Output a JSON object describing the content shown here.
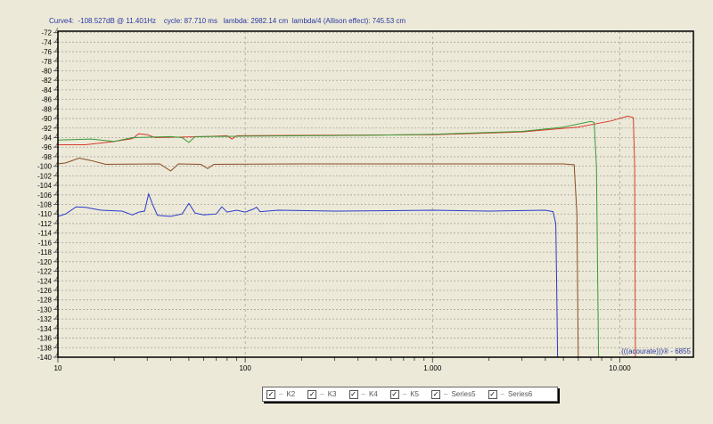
{
  "readout": "Curve4:  -108.527dB @ 11.401Hz    cycle: 87.710 ms   lambda: 2982.14 cm  lambda/4 (Allison effect): 745.53 cm",
  "watermark": "(((acourate)))® - 6855",
  "colors": {
    "bg": "#ece9d8",
    "grid": "#a8a49a"
  },
  "chart_data": {
    "type": "line",
    "xscale": "log",
    "xlim": [
      10,
      24700
    ],
    "ylim": [
      -140,
      -71.7
    ],
    "xticks": [
      {
        "v": 10,
        "label": "10"
      },
      {
        "v": 100,
        "label": "100"
      },
      {
        "v": 1000,
        "label": "1.000"
      },
      {
        "v": 10000,
        "label": "10.000"
      }
    ],
    "yticks": [
      -72,
      -74,
      -76,
      -78,
      -80,
      -82,
      -84,
      -86,
      -88,
      -90,
      -92,
      -94,
      -96,
      -98,
      -100,
      -102,
      -104,
      -106,
      -108,
      -110,
      -112,
      -114,
      -116,
      -118,
      -120,
      -122,
      -124,
      -126,
      -128,
      -130,
      -132,
      -134,
      -136,
      -138,
      -140
    ],
    "grid": true,
    "legend_position": "bottom-center",
    "series": [
      {
        "name": "K2",
        "color": "#d83a2a",
        "points": [
          [
            10,
            -95.5
          ],
          [
            14,
            -95.5
          ],
          [
            20,
            -94.8
          ],
          [
            25,
            -94.2
          ],
          [
            27,
            -93.2
          ],
          [
            30,
            -93.4
          ],
          [
            33,
            -94
          ],
          [
            60,
            -93.8
          ],
          [
            80,
            -93.6
          ],
          [
            85,
            -94.3
          ],
          [
            90,
            -93.6
          ],
          [
            300,
            -93.5
          ],
          [
            1000,
            -93.4
          ],
          [
            3000,
            -92.8
          ],
          [
            6000,
            -91.8
          ],
          [
            9000,
            -90.5
          ],
          [
            11000,
            -89.5
          ],
          [
            11800,
            -89.8
          ],
          [
            12000,
            -100
          ],
          [
            12100,
            -140
          ]
        ]
      },
      {
        "name": "K3",
        "color": "#3a9a3a",
        "points": [
          [
            10,
            -94.5
          ],
          [
            15,
            -94.3
          ],
          [
            20,
            -94.8
          ],
          [
            25,
            -94
          ],
          [
            40,
            -93.8
          ],
          [
            46,
            -94
          ],
          [
            50,
            -95
          ],
          [
            54,
            -93.8
          ],
          [
            100,
            -93.7
          ],
          [
            500,
            -93.5
          ],
          [
            1000,
            -93.3
          ],
          [
            3000,
            -92.7
          ],
          [
            5000,
            -91.8
          ],
          [
            7000,
            -90.6
          ],
          [
            7300,
            -90.8
          ],
          [
            7500,
            -100
          ],
          [
            7700,
            -140
          ]
        ]
      },
      {
        "name": "K4",
        "color": "#8a4a22",
        "points": [
          [
            10,
            -99.5
          ],
          [
            11,
            -99.3
          ],
          [
            13,
            -98.3
          ],
          [
            15,
            -98.8
          ],
          [
            18,
            -99.6
          ],
          [
            35,
            -99.5
          ],
          [
            40,
            -101
          ],
          [
            44,
            -99.5
          ],
          [
            58,
            -99.6
          ],
          [
            63,
            -100.5
          ],
          [
            68,
            -99.6
          ],
          [
            200,
            -99.5
          ],
          [
            1000,
            -99.5
          ],
          [
            5000,
            -99.5
          ],
          [
            5700,
            -99.7
          ],
          [
            5900,
            -110
          ],
          [
            6000,
            -140
          ]
        ]
      },
      {
        "name": "K5",
        "color": "#2a3ac8",
        "points": [
          [
            10,
            -110.5
          ],
          [
            11,
            -110
          ],
          [
            12.5,
            -108.5
          ],
          [
            14,
            -108.6
          ],
          [
            17,
            -109.2
          ],
          [
            22,
            -109.4
          ],
          [
            25,
            -110.2
          ],
          [
            27,
            -109.6
          ],
          [
            29,
            -109.4
          ],
          [
            30.5,
            -105.8
          ],
          [
            32,
            -108
          ],
          [
            34,
            -110.3
          ],
          [
            40,
            -110.5
          ],
          [
            46,
            -110
          ],
          [
            50,
            -107.8
          ],
          [
            54,
            -109.8
          ],
          [
            60,
            -110.2
          ],
          [
            70,
            -110
          ],
          [
            75,
            -108.5
          ],
          [
            80,
            -109.6
          ],
          [
            90,
            -109.2
          ],
          [
            100,
            -109.6
          ],
          [
            110,
            -109
          ],
          [
            115,
            -108.6
          ],
          [
            120,
            -109.5
          ],
          [
            150,
            -109.2
          ],
          [
            300,
            -109.4
          ],
          [
            600,
            -109.3
          ],
          [
            1000,
            -109.2
          ],
          [
            2000,
            -109.4
          ],
          [
            4000,
            -109.2
          ],
          [
            4400,
            -109.5
          ],
          [
            4550,
            -112
          ],
          [
            4600,
            -125
          ],
          [
            4650,
            -140
          ]
        ]
      },
      {
        "name": "Series5",
        "color": "#888888",
        "points": []
      },
      {
        "name": "Series6",
        "color": "#888888",
        "points": []
      }
    ]
  },
  "legend": [
    {
      "label": "K2",
      "checked": true
    },
    {
      "label": "K3",
      "checked": true
    },
    {
      "label": "K4",
      "checked": true
    },
    {
      "label": "K5",
      "checked": true
    },
    {
      "label": "Series5",
      "checked": true
    },
    {
      "label": "Series6",
      "checked": true
    }
  ]
}
